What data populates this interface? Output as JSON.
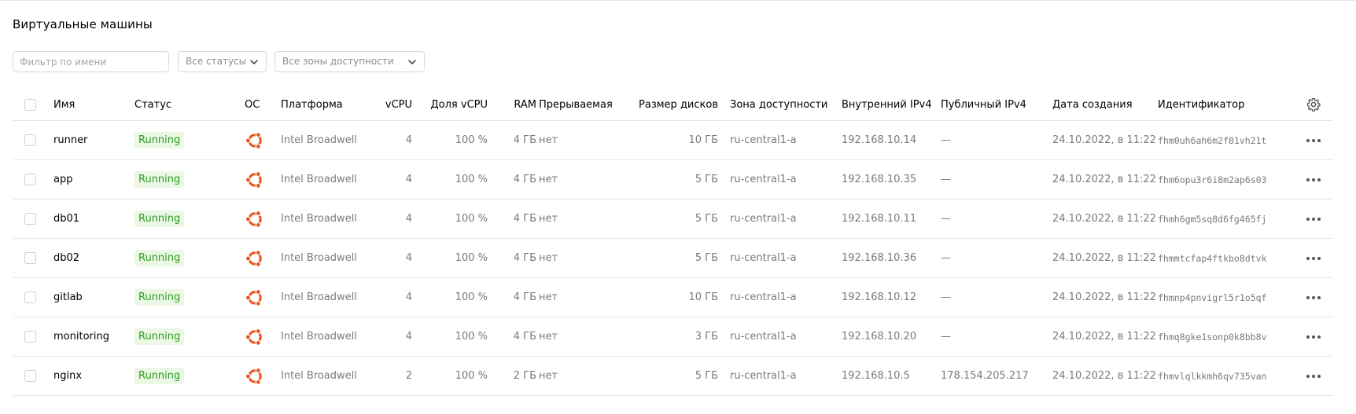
{
  "page": {
    "title": "Виртуальные машины"
  },
  "filters": {
    "name_placeholder": "Фильтр по имени",
    "name_value": "",
    "status_selected": "Все статусы",
    "zone_selected": "Все зоны доступности"
  },
  "table": {
    "columns": {
      "name": "Имя",
      "status": "Статус",
      "os": "ОС",
      "platform": "Платформа",
      "vcpu": "vCPU",
      "vcpu_share": "Доля vCPU",
      "ram": "RAM",
      "preemptible": "Прерываемая",
      "disk_size": "Размер дисков",
      "zone": "Зона доступности",
      "internal_ip": "Внутренний IPv4",
      "public_ip": "Публичный IPv4",
      "created": "Дата создания",
      "id": "Идентификатор"
    },
    "rows": [
      {
        "name": "runner",
        "status": "Running",
        "os_icon": "ubuntu-icon",
        "platform": "Intel Broadwell",
        "vcpu": "4",
        "vcpu_share": "100 %",
        "ram": "4 ГБ",
        "preemptible": "нет",
        "disk_size": "10 ГБ",
        "zone": "ru-central1-a",
        "internal_ip": "192.168.10.14",
        "public_ip": "—",
        "created": "24.10.2022, в 11:22",
        "id": "fhm0uh6ah6m2f81vh21t"
      },
      {
        "name": "app",
        "status": "Running",
        "os_icon": "ubuntu-icon",
        "platform": "Intel Broadwell",
        "vcpu": "4",
        "vcpu_share": "100 %",
        "ram": "4 ГБ",
        "preemptible": "нет",
        "disk_size": "5 ГБ",
        "zone": "ru-central1-a",
        "internal_ip": "192.168.10.35",
        "public_ip": "—",
        "created": "24.10.2022, в 11:22",
        "id": "fhm6opu3r6i8m2ap6s03"
      },
      {
        "name": "db01",
        "status": "Running",
        "os_icon": "ubuntu-icon",
        "platform": "Intel Broadwell",
        "vcpu": "4",
        "vcpu_share": "100 %",
        "ram": "4 ГБ",
        "preemptible": "нет",
        "disk_size": "5 ГБ",
        "zone": "ru-central1-a",
        "internal_ip": "192.168.10.11",
        "public_ip": "—",
        "created": "24.10.2022, в 11:22",
        "id": "fhmh6gm5sq8d6fg465fj"
      },
      {
        "name": "db02",
        "status": "Running",
        "os_icon": "ubuntu-icon",
        "platform": "Intel Broadwell",
        "vcpu": "4",
        "vcpu_share": "100 %",
        "ram": "4 ГБ",
        "preemptible": "нет",
        "disk_size": "5 ГБ",
        "zone": "ru-central1-a",
        "internal_ip": "192.168.10.36",
        "public_ip": "—",
        "created": "24.10.2022, в 11:22",
        "id": "fhmmtcfap4ftkbo8dtvk"
      },
      {
        "name": "gitlab",
        "status": "Running",
        "os_icon": "ubuntu-icon",
        "platform": "Intel Broadwell",
        "vcpu": "4",
        "vcpu_share": "100 %",
        "ram": "4 ГБ",
        "preemptible": "нет",
        "disk_size": "10 ГБ",
        "zone": "ru-central1-a",
        "internal_ip": "192.168.10.12",
        "public_ip": "—",
        "created": "24.10.2022, в 11:22",
        "id": "fhmnp4pnvigrl5r1o5qf"
      },
      {
        "name": "monitoring",
        "status": "Running",
        "os_icon": "ubuntu-icon",
        "platform": "Intel Broadwell",
        "vcpu": "4",
        "vcpu_share": "100 %",
        "ram": "4 ГБ",
        "preemptible": "нет",
        "disk_size": "3 ГБ",
        "zone": "ru-central1-a",
        "internal_ip": "192.168.10.20",
        "public_ip": "—",
        "created": "24.10.2022, в 11:22",
        "id": "fhmq8gke1sonp0k8bb8v"
      },
      {
        "name": "nginx",
        "status": "Running",
        "os_icon": "ubuntu-icon",
        "platform": "Intel Broadwell",
        "vcpu": "2",
        "vcpu_share": "100 %",
        "ram": "2 ГБ",
        "preemptible": "нет",
        "disk_size": "5 ГБ",
        "zone": "ru-central1-a",
        "internal_ip": "192.168.10.5",
        "public_ip": "178.154.205.217",
        "created": "24.10.2022, в 11:22",
        "id": "fhmvlqlkkmh6qv735van"
      }
    ]
  },
  "colors": {
    "status_running_text": "#2e9a25",
    "status_running_bg": "#eaf8e4",
    "ubuntu_orange": "#e95420",
    "border": "#e5e5e5",
    "muted_text": "#7a7a7a"
  }
}
